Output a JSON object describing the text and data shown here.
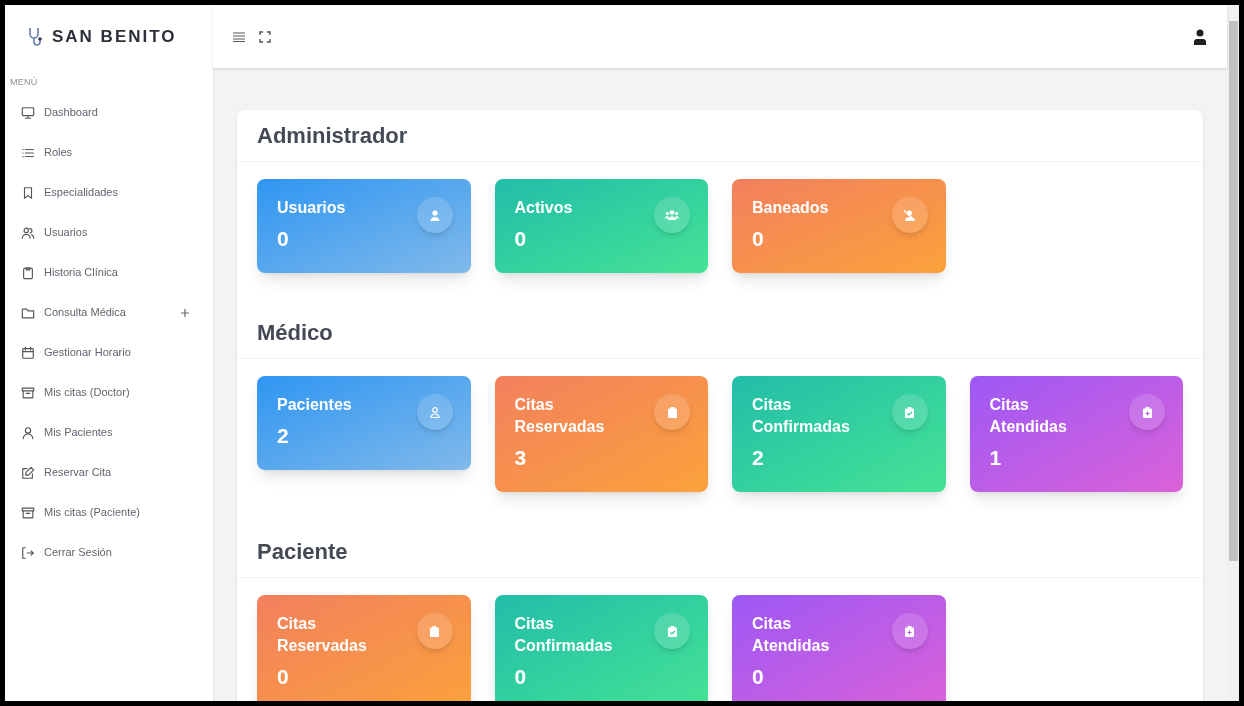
{
  "brand": {
    "name": "SAN BENITO"
  },
  "sidebar": {
    "heading": "MENÚ",
    "items": [
      {
        "label": "Dashboard",
        "kind": "monitor"
      },
      {
        "label": "Roles",
        "kind": "list"
      },
      {
        "label": "Especialidades",
        "kind": "bookmark"
      },
      {
        "label": "Usuarios",
        "kind": "users"
      },
      {
        "label": "Historia Clínica",
        "kind": "clipboard"
      },
      {
        "label": "Consulta Médica",
        "kind": "folder",
        "expanded": false
      },
      {
        "label": "Gestionar Horario",
        "kind": "calendar"
      },
      {
        "label": "Mis citas (Doctor)",
        "kind": "archive"
      },
      {
        "label": "Mis Pacientes",
        "kind": "user"
      },
      {
        "label": "Reservar Cita",
        "kind": "edit"
      },
      {
        "label": "Mis citas (Paciente)",
        "kind": "archive"
      },
      {
        "label": "Cerrar Sesión",
        "kind": "logout"
      }
    ]
  },
  "sections": [
    {
      "title": "Administrador",
      "cards": [
        {
          "label": "Usuarios",
          "value": "0",
          "color": "#2f96f2",
          "kind": "user"
        },
        {
          "label": "Activos",
          "value": "0",
          "color": "#22bda9",
          "kind": "users"
        },
        {
          "label": "Baneados",
          "value": "0",
          "color": "#f2805e",
          "kind": "user-slash"
        }
      ]
    },
    {
      "title": "Médico",
      "cards": [
        {
          "label": "Pacientes",
          "value": "2",
          "color": "#2f96f2",
          "kind": "user-outline"
        },
        {
          "label": "Citas Reservadas",
          "value": "3",
          "color": "#f2805e",
          "kind": "clipboard"
        },
        {
          "label": "Citas Confirmadas",
          "value": "2",
          "color": "#22bda9",
          "kind": "clipboard-check"
        },
        {
          "label": "Citas Atendidas",
          "value": "1",
          "color": "#9d58f5",
          "kind": "clipboard-plus"
        }
      ]
    },
    {
      "title": "Paciente",
      "cards": [
        {
          "label": "Citas Reservadas",
          "value": "0",
          "color": "#f2805e",
          "kind": "clipboard"
        },
        {
          "label": "Citas Confirmadas",
          "value": "0",
          "color": "#22bda9",
          "kind": "clipboard-check"
        },
        {
          "label": "Citas Atendidas",
          "value": "0",
          "color": "#9d58f5",
          "kind": "clipboard-plus"
        }
      ]
    }
  ]
}
